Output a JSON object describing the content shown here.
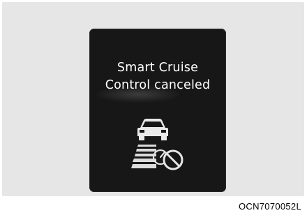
{
  "cluster_display": {
    "message_line1": "Smart Cruise",
    "message_line2": "Control canceled",
    "icon": "smart-cruise-canceled-icon",
    "background_color": "#171717",
    "text_color": "#ffffff"
  },
  "figure": {
    "code": "OCN7070052L"
  }
}
